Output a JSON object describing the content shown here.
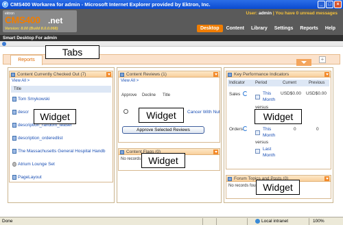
{
  "window": {
    "title": "CMS400 Workarea for admin - Microsoft Internet Explorer provided by Ektron, Inc.",
    "controls": [
      "_",
      "□",
      "×"
    ]
  },
  "header": {
    "logo_small": "ektron",
    "logo_cms": "CMS",
    "logo_num": "400",
    "logo_net": ".net",
    "version": "Version: 8.00 (Build 8.0.0.068)",
    "user_prefix": "User: ",
    "user_name": "admin",
    "user_mid": " | You have ",
    "messages": "0 unread messages",
    "nav": [
      "Desktop",
      "Content",
      "Library",
      "Settings",
      "Reports",
      "Help"
    ],
    "active_nav": "Desktop"
  },
  "subbar": {
    "title": "Smart Desktop For admin"
  },
  "tabs": {
    "items": [
      "Reports"
    ],
    "add": "+"
  },
  "annotations": {
    "tabs": "Tabs",
    "widget": "Widget"
  },
  "widgets": {
    "checked_out": {
      "title": "Content Currently Checked Out (7)",
      "view_all": "View All >",
      "column": "Title",
      "rows": [
        "Tom Smykowski",
        "descr",
        "description_random_teaser",
        "description_orderedlist",
        "The Massachusetts General Hospital Handb",
        "Atrium Lounge Set",
        "PageLayout"
      ]
    },
    "reviews": {
      "title": "Content Reviews (1)",
      "view_all": "View All >",
      "columns": [
        "Approve",
        "Decline",
        "Title"
      ],
      "row_title": "Cancer With Nut",
      "approve_button": "Approve Selected Reviews"
    },
    "flags": {
      "title": "Content Flags (0)",
      "empty": "No records found"
    },
    "kpi": {
      "title": "Key Performance Indicators",
      "columns": [
        "Indicator",
        "Period",
        "Current",
        "Previous"
      ],
      "sales_label": "Sales",
      "sales_period_1": "This",
      "sales_period_2": "Month",
      "sales_current": "USD$0.00",
      "sales_previous": "USD$0.00",
      "versus": "versus",
      "last_1": "Last",
      "last_2": "Month",
      "orders_label": "Orders",
      "orders_current": "0",
      "orders_previous": "0"
    },
    "forum": {
      "title": "Forum Topics and Posts (0)",
      "empty": "No records found"
    }
  },
  "status": {
    "done": "Done",
    "zone": "Local intranet",
    "zoom": "100%"
  }
}
